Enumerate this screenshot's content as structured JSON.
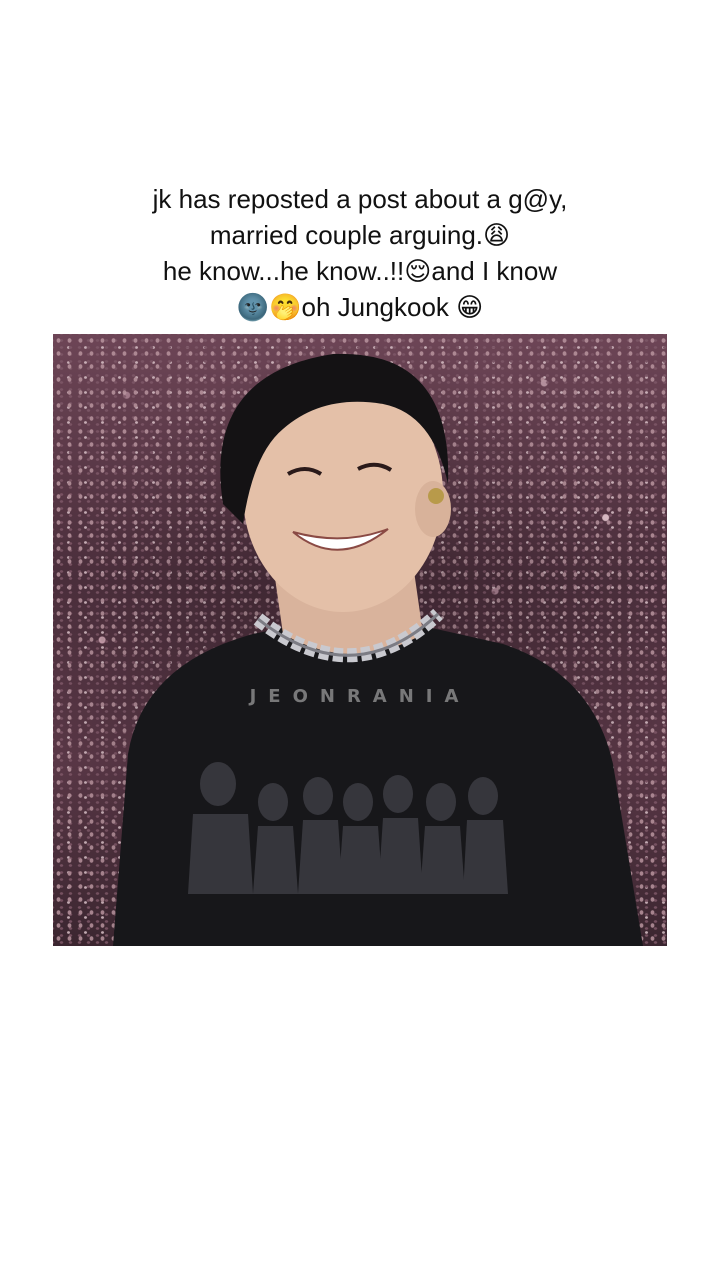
{
  "caption": {
    "line1": "jk has reposted a post about a g@y,",
    "line2": "married couple arguing.😩",
    "line3": "he know...he know..!!😌and I know",
    "line4": "🌚🤭oh Jungkook 😁"
  },
  "photo": {
    "watermark": "JEONRANIA"
  }
}
